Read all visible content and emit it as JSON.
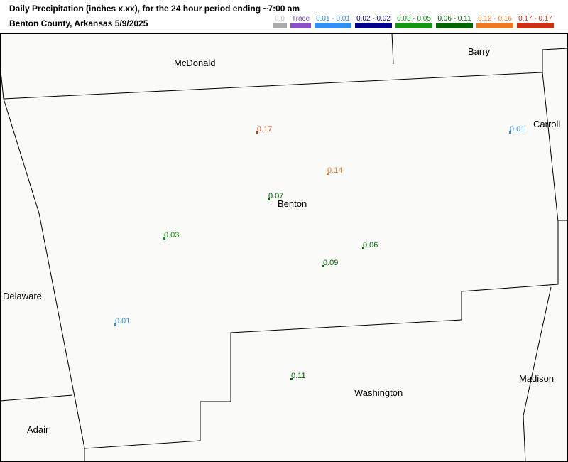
{
  "title_line1": "Daily Precipitation (inches  x.xx),  for the 24 hour period ending ~7:00 am",
  "title_line2": "Benton County, Arkansas  5/9/2025",
  "legend": [
    {
      "label": "0.0",
      "color": "#aaaaaa",
      "text_color": "#bbbbbb"
    },
    {
      "label": "Trace",
      "color": "#8b50c8",
      "text_color": "#7a48b8"
    },
    {
      "label": "0.01 - 0.01",
      "color": "#2d8ff0",
      "text_color": "#2d8ff0"
    },
    {
      "label": "0.02 - 0.02",
      "color": "#00008b",
      "text_color": "#00008b"
    },
    {
      "label": "0.03 - 0.05",
      "color": "#109610",
      "text_color": "#109610"
    },
    {
      "label": "0.06 - 0.11",
      "color": "#006400",
      "text_color": "#006400"
    },
    {
      "label": "0.12 - 0.16",
      "color": "#f07820",
      "text_color": "#f07820"
    },
    {
      "label": "0.17 - 0.17",
      "color": "#c83210",
      "text_color": "#c83210"
    }
  ],
  "map_background": "#fafaf8",
  "counties": [
    {
      "name": "McDonald"
    },
    {
      "name": "Barry"
    },
    {
      "name": "Carroll"
    },
    {
      "name": "Benton"
    },
    {
      "name": "Delaware"
    },
    {
      "name": "Madison"
    },
    {
      "name": "Washington"
    },
    {
      "name": "Adair"
    }
  ],
  "observations": [
    {
      "value": "0.17",
      "color": "#c83210"
    },
    {
      "value": "0.01",
      "color": "#2d8ff0"
    },
    {
      "value": "0.14",
      "color": "#f07820"
    },
    {
      "value": "0.07",
      "color": "#006400"
    },
    {
      "value": "0.03",
      "color": "#109610"
    },
    {
      "value": "0.06",
      "color": "#006400"
    },
    {
      "value": "0.09",
      "color": "#006400"
    },
    {
      "value": "0.01",
      "color": "#2d8ff0"
    },
    {
      "value": "0.11",
      "color": "#006400"
    }
  ]
}
